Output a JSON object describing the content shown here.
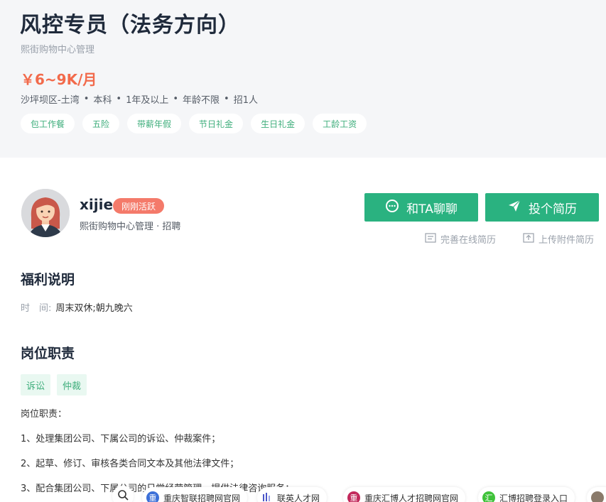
{
  "job": {
    "title": "风控专员（法务方向）",
    "company": "熙街购物中心管理",
    "salary": "￥6~9K/月",
    "meta": [
      "沙坪坝区-土湾",
      "本科",
      "1年及以上",
      "年龄不限",
      "招1人"
    ],
    "benefits": [
      "包工作餐",
      "五险",
      "带薪年假",
      "节日礼金",
      "生日礼金",
      "工龄工资"
    ]
  },
  "recruiter": {
    "name": "xijie",
    "badge": "刚刚活跃",
    "subtitle": "熙街购物中心管理 · 招聘"
  },
  "actions": {
    "chat_label": "和TA聊聊",
    "apply_label": "投个简历",
    "online_resume": "完善在线简历",
    "upload_resume": "上传附件简历"
  },
  "welfare": {
    "title": "福利说明",
    "time_label": "时　间:",
    "time_value": "周末双休;朝九晚六"
  },
  "duties": {
    "title": "岗位职责",
    "tags": [
      "诉讼",
      "仲裁"
    ],
    "lines": [
      "岗位职责：",
      "1、处理集团公司、下属公司的诉讼、仲裁案件；",
      "2、起草、修订、审核各类合同文本及其他法律文件；",
      "3、配合集团公司、下属公司的日常经营管理，提供法律咨询服务；"
    ]
  },
  "bottom_links": [
    {
      "icon_text": "重",
      "label": "重庆智联招聘网官网",
      "color": "#3b6fd8"
    },
    {
      "icon_text": "",
      "label": "联英人才网",
      "color": "#4a55c9"
    },
    {
      "icon_text": "重",
      "label": "重庆汇博人才招聘网官网",
      "color": "#c2285b"
    },
    {
      "icon_text": "汇",
      "label": "汇博招聘登录入口",
      "color": "#3fc23a"
    }
  ],
  "icons": {
    "chat": "chat-bubble-icon",
    "apply": "paper-plane-icon",
    "resume": "document-icon",
    "upload": "upload-icon",
    "search": "search-icon"
  },
  "colors": {
    "accent": "#2ab280",
    "salary": "#f26a4b",
    "badge": "#f47a6a"
  }
}
